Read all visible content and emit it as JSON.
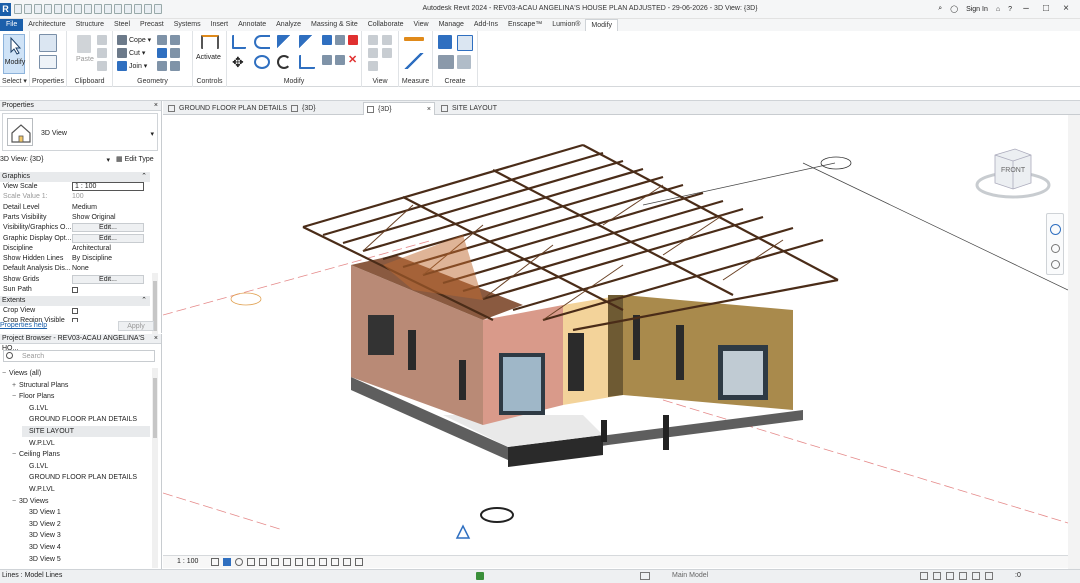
{
  "title": "Autodesk Revit 2024 - REV03-ACAU ANGELINA'S HOUSE PLAN ADJUSTED - 29-06-2026 - 3D View: {3D}",
  "app_logo": "R",
  "signin": "Sign In",
  "tabs": [
    "File",
    "Architecture",
    "Structure",
    "Steel",
    "Precast",
    "Systems",
    "Insert",
    "Annotate",
    "Analyze",
    "Massing & Site",
    "Collaborate",
    "View",
    "Manage",
    "Add-Ins",
    "Enscape™",
    "Lumion®",
    "Modify"
  ],
  "active_tab_index": 16,
  "ribbon": {
    "select_label": "Select ▾",
    "modify_label": "Modify",
    "properties_label": "Properties",
    "clipboard_label": "Clipboard",
    "paste_label": "Paste",
    "geometry_label": "Geometry",
    "cope_label": "Cope ▾",
    "cut_label": "Cut ▾",
    "join_label": "Join ▾",
    "controls_label": "Controls",
    "activate_label": "Activate",
    "modify_panel_label": "Modify",
    "view_label": "View",
    "measure_label": "Measure",
    "create_label": "Create"
  },
  "properties": {
    "header": "Properties",
    "type_name": "3D View",
    "view_selector": "3D View: {3D}",
    "edit_type": "Edit Type",
    "section_graphics": "Graphics",
    "section_extents": "Extents",
    "rows": [
      {
        "k": "View Scale",
        "v": "1 : 100",
        "style": "inp"
      },
      {
        "k": "Scale Value    1:",
        "v": "100",
        "style": "grey"
      },
      {
        "k": "Detail Level",
        "v": "Medium",
        "style": ""
      },
      {
        "k": "Parts Visibility",
        "v": "Show Original",
        "style": ""
      },
      {
        "k": "Visibility/Graphics O...",
        "v": "Edit...",
        "style": "btn"
      },
      {
        "k": "Graphic Display Opt...",
        "v": "Edit...",
        "style": "btn"
      },
      {
        "k": "Discipline",
        "v": "Architectural",
        "style": ""
      },
      {
        "k": "Show Hidden Lines",
        "v": "By Discipline",
        "style": ""
      },
      {
        "k": "Default Analysis Dis...",
        "v": "None",
        "style": ""
      },
      {
        "k": "Show Grids",
        "v": "Edit...",
        "style": "btn"
      },
      {
        "k": "Sun Path",
        "v": "",
        "style": "cb"
      }
    ],
    "extent_rows": [
      {
        "k": "Crop View",
        "v": "",
        "style": "cb"
      },
      {
        "k": "Crop Region Visible",
        "v": "",
        "style": "cb"
      }
    ],
    "help": "Properties help",
    "apply": "Apply"
  },
  "browser": {
    "header": "Project Browser - REV03-ACAU ANGELINA'S HO...",
    "search_placeholder": "Search",
    "items": [
      {
        "t": "Views (all)",
        "lvl": 0,
        "g": "−"
      },
      {
        "t": "Structural Plans",
        "lvl": 1,
        "g": "+"
      },
      {
        "t": "Floor Plans",
        "lvl": 1,
        "g": "−"
      },
      {
        "t": "G.LVL",
        "lvl": 2,
        "g": ""
      },
      {
        "t": "GROUND FLOOR PLAN DETAILS",
        "lvl": 2,
        "g": ""
      },
      {
        "t": "SITE LAYOUT",
        "lvl": 2,
        "g": "",
        "sel": true
      },
      {
        "t": "W.P.LVL",
        "lvl": 2,
        "g": ""
      },
      {
        "t": "Ceiling Plans",
        "lvl": 1,
        "g": "−"
      },
      {
        "t": "G.LVL",
        "lvl": 2,
        "g": ""
      },
      {
        "t": "GROUND FLOOR PLAN DETAILS",
        "lvl": 2,
        "g": ""
      },
      {
        "t": "W.P.LVL",
        "lvl": 2,
        "g": ""
      },
      {
        "t": "3D Views",
        "lvl": 1,
        "g": "−"
      },
      {
        "t": "3D View 1",
        "lvl": 2,
        "g": ""
      },
      {
        "t": "3D View 2",
        "lvl": 2,
        "g": ""
      },
      {
        "t": "3D View 3",
        "lvl": 2,
        "g": ""
      },
      {
        "t": "3D View 4",
        "lvl": 2,
        "g": ""
      },
      {
        "t": "3D View 5",
        "lvl": 2,
        "g": ""
      }
    ]
  },
  "view_tabs": [
    {
      "label": "GROUND FLOOR PLAN DETAILS",
      "active": false
    },
    {
      "label": "{3D}",
      "active": false
    },
    {
      "label": "{3D}",
      "active": true
    },
    {
      "label": "SITE LAYOUT",
      "active": false
    }
  ],
  "viewcube_label": "FRONT",
  "view_scale": "1 : 100",
  "status_text": "Lines : Model Lines",
  "main_model": "Main Model",
  "status_right": ":0",
  "colors": {
    "accent": "#1b5faa",
    "wall_pink": "#d99a8a",
    "wall_yellow": "#f3d39a",
    "wall_brown": "#a98a4c",
    "truss": "#4a2c18"
  }
}
